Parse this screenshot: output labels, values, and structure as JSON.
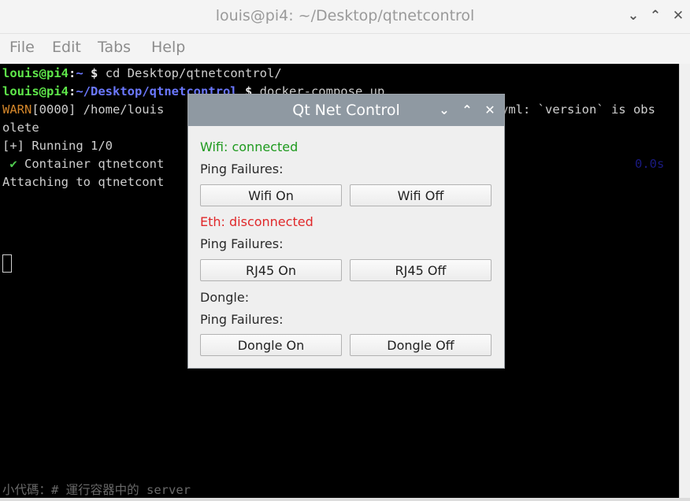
{
  "terminal": {
    "title": "louis@pi4: ~/Desktop/qtnetcontrol",
    "menu": [
      "File",
      "Edit",
      "Tabs",
      "Help"
    ],
    "lines": {
      "l1_user": "louis@pi4",
      "l1_sep": ":",
      "l1_path": "~",
      "l1_prompt": " $ ",
      "l1_cmd": "cd Desktop/qtnetcontrol/",
      "l2_user": "louis@pi4",
      "l2_sep": ":",
      "l2_path": "~/Desktop/qtnetcontrol",
      "l2_prompt": " $ ",
      "l2_cmd": "docker-compose up",
      "l3_warn": "WARN",
      "l3_rest": "[0000] /home/louis",
      "l3_tail": "yml: `version` is obs",
      "l4": "olete",
      "l5": "[+] Running 1/0",
      "l6_check": " ✔ ",
      "l6_rest": "Container qtnetcont",
      "l6_time": "0.0s",
      "l7": "Attaching to qtnetcont",
      "bottom": "小代碼：# 運行容器中的 server"
    }
  },
  "dialog": {
    "title": "Qt Net Control",
    "wifi_status": "Wifi: connected",
    "wifi_ping": "Ping Failures:",
    "wifi_on": "Wifi On",
    "wifi_off": "Wifi Off",
    "eth_status": "Eth: disconnected",
    "eth_ping": "Ping Failures:",
    "rj45_on": "RJ45 On",
    "rj45_off": "RJ45 Off",
    "dongle_status": "Dongle:",
    "dongle_ping": "Ping Failures:",
    "dongle_on": "Dongle On",
    "dongle_off": "Dongle Off"
  },
  "colors": {
    "connected": "#1e9a1e",
    "disconnected": "#e0282a",
    "prompt_user": "#5ee64a",
    "prompt_path": "#6b78ff",
    "warn": "#d4862a"
  }
}
